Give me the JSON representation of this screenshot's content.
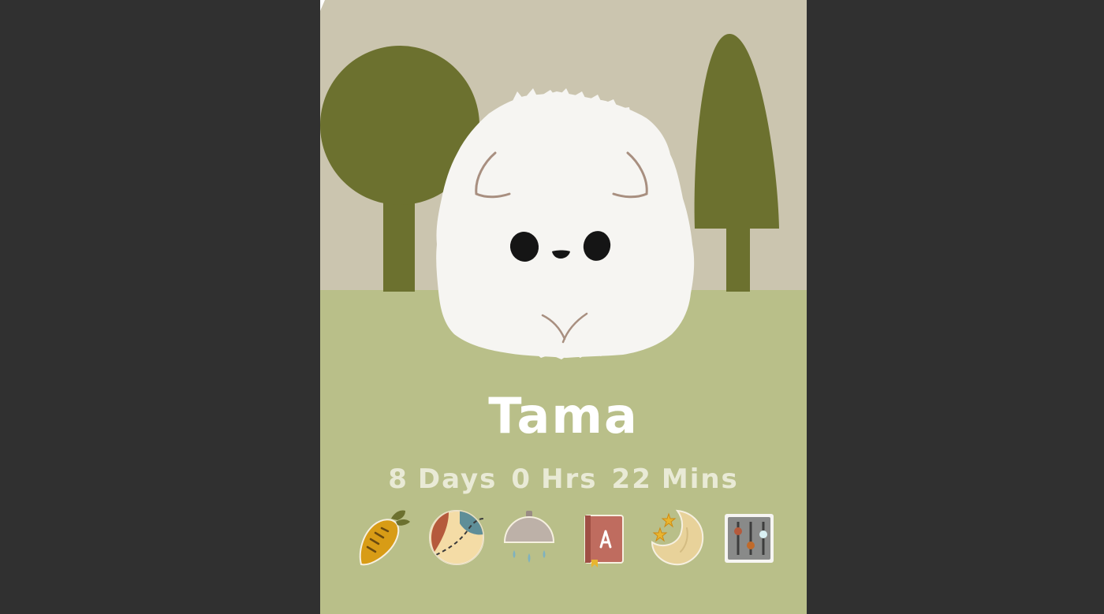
{
  "pet": {
    "name": "Tama"
  },
  "age": {
    "days_value": "8",
    "days_unit": "Days",
    "hours_value": "0",
    "hours_unit": "Hrs",
    "minutes_value": "22",
    "minutes_unit": "Mins"
  },
  "toolbar": {
    "items": [
      {
        "icon": "carrot-icon"
      },
      {
        "icon": "ball-icon"
      },
      {
        "icon": "shower-icon"
      },
      {
        "icon": "book-icon"
      },
      {
        "icon": "moon-icon"
      },
      {
        "icon": "settings-sliders-icon"
      }
    ]
  },
  "colors": {
    "background": "#303030",
    "sky": "#cbc5af",
    "grass": "#b9bf89",
    "trees": "#6c712f",
    "pet_fur": "#f6f5f2",
    "text": "#ffffff"
  }
}
